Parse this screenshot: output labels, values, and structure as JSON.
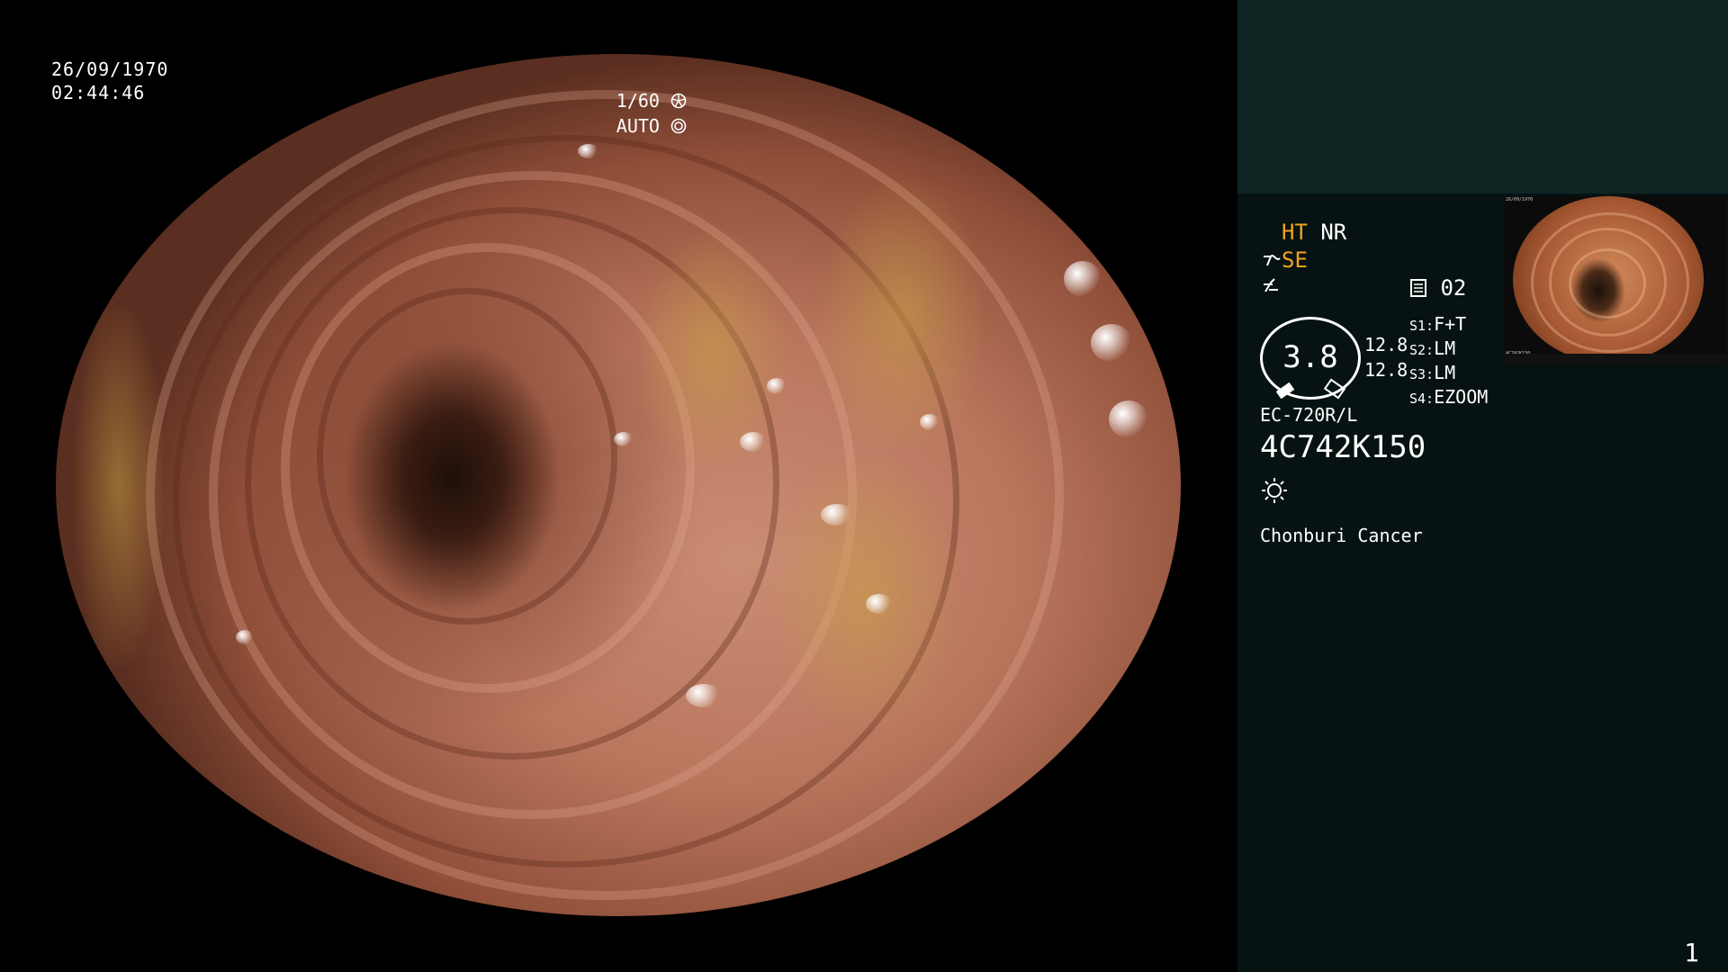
{
  "scope": {
    "date": "26/09/1970",
    "time": "02:44:46",
    "shutter": "1/60",
    "shutter_icon": "aperture-icon",
    "iris": "AUTO",
    "iris_icon": "iris-icon"
  },
  "panel": {
    "ht": "HT",
    "nr": "NR",
    "se": "SE",
    "se_icon": "structure-enhance-icon",
    "curve_icon": "color-curve-icon",
    "memory_icon": "memory-card-icon",
    "memory_count": "02",
    "gauge_value": "3.8",
    "gauge_readings": [
      "12.8",
      "12.8"
    ],
    "switches": [
      {
        "key": "S1:",
        "value": "F+T"
      },
      {
        "key": "S2:",
        "value": "LM"
      },
      {
        "key": "S3:",
        "value": "LM"
      },
      {
        "key": "S4:",
        "value": "EZOOM"
      }
    ],
    "scope_model": "EC-720R/L",
    "serial": "4C742K150",
    "light_icon": "light-source-icon",
    "hospital": "Chonburi Cancer",
    "page_number": "1"
  },
  "colors": {
    "amber": "#f3a21b",
    "panel_bg": "#061312",
    "panel_top_bg": "#0e2524"
  }
}
